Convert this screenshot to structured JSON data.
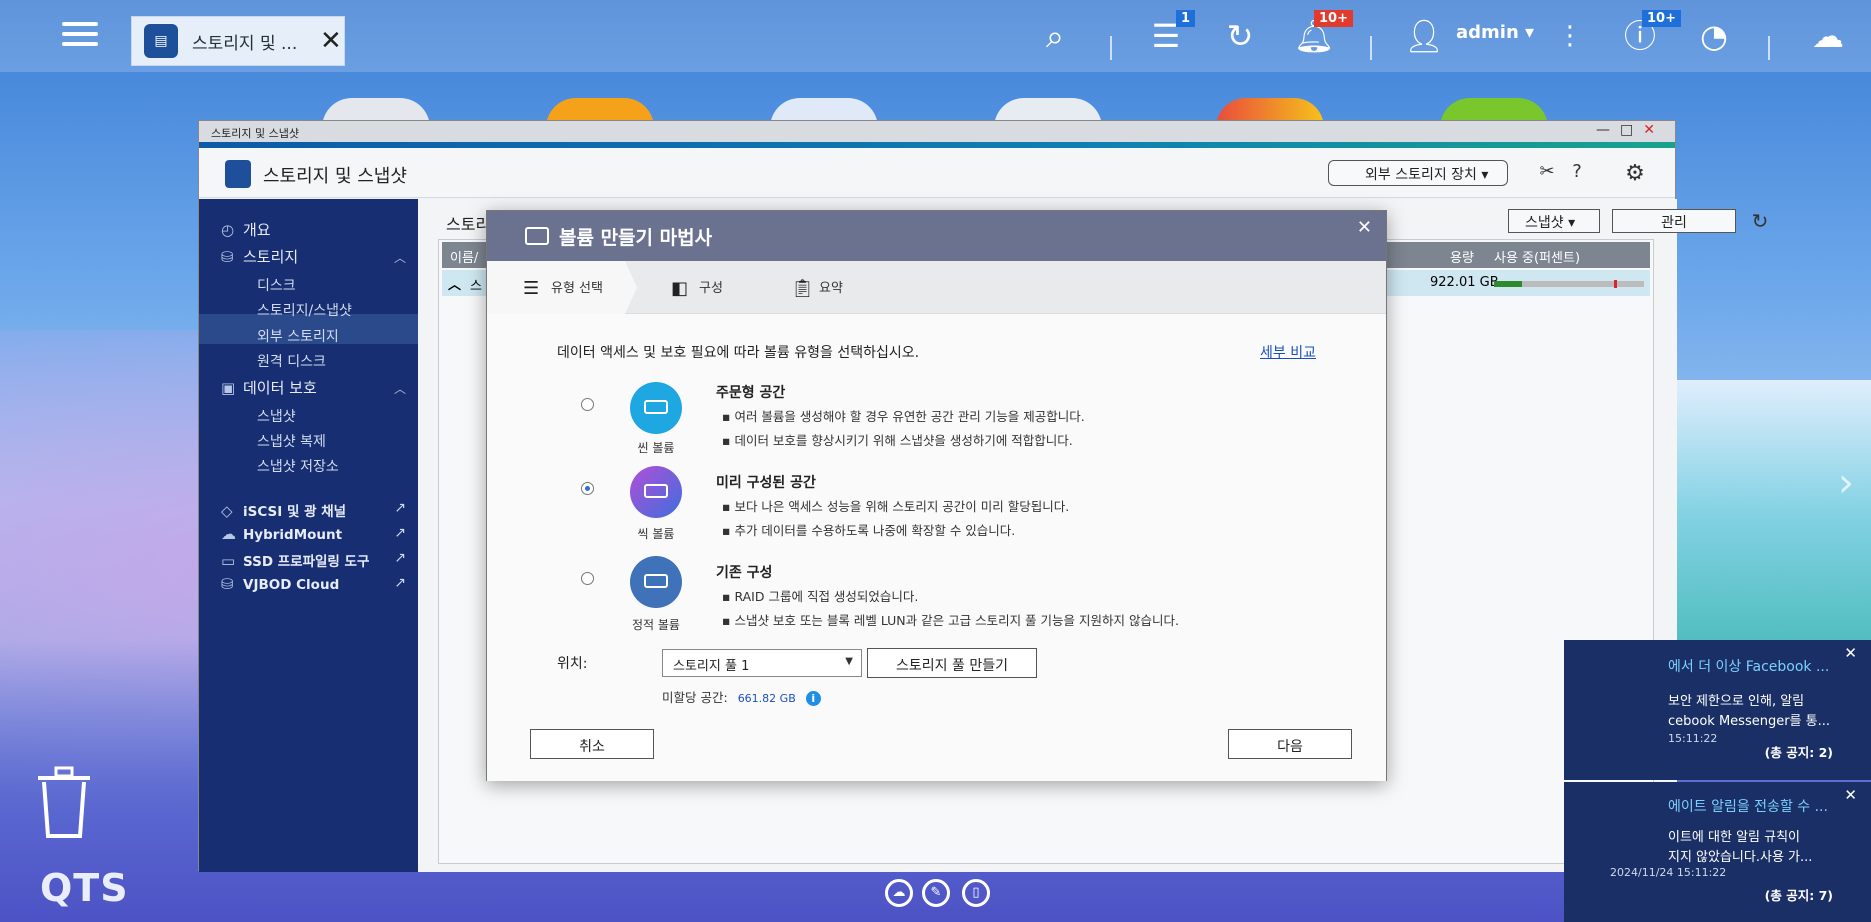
{
  "topbar": {
    "tab_label": "스토리지 및 ...",
    "tab_badge_tasks": "1",
    "tab_badge_notifications": "10+",
    "user": "admin",
    "tab_badge_info": "10+"
  },
  "window": {
    "titlebar": "스토리지 및 스냅샷",
    "app_title": "스토리지 및 스냅샷",
    "external_device_label": "외부 스토리지 장치"
  },
  "sidebar": {
    "overview": "개요",
    "storage": "스토리지",
    "disks": "디스크",
    "storage_snapshots": "스토리지/스냅샷",
    "external_storage": "외부 스토리지",
    "remote_disk": "원격 디스크",
    "data_protection": "데이터 보호",
    "snapshot": "스냅샷",
    "snapshot_replica": "스냅샷 복제",
    "snapshot_vault": "스냅샷 저장소",
    "iscsi": "iSCSI 및 광 채널",
    "hybridmount": "HybridMount",
    "ssd_profiling": "SSD 프로파일링 도구",
    "vjbod": "VJBOD Cloud"
  },
  "content": {
    "heading": "스토리",
    "snapshot_btn": "스냅샷",
    "manage_btn": "관리",
    "col_name": "이름/",
    "col_capacity": "용량",
    "col_usage": "사용 중(퍼센트)",
    "row_prefix": "스",
    "row_capacity": "922.01 GB"
  },
  "dialog": {
    "title": "볼륨 만들기 마법사",
    "steps": [
      "유형 선택",
      "구성",
      "요약"
    ],
    "intro": "데이터 액세스 및 보호 필요에 따라 볼륨 유형을 선택하십시오.",
    "compare_link": "세부 비교",
    "options": [
      {
        "label": "씬 볼륨",
        "title": "주문형 공간",
        "bullets": [
          "여러 볼륨을 생성해야 할 경우 유연한 공간 관리 기능을 제공합니다.",
          "데이터 보호를 향상시키기 위해 스냅샷을 생성하기에 적합합니다."
        ],
        "color": "#1ea7e0"
      },
      {
        "label": "씩 볼륨",
        "title": "미리 구성된 공간",
        "bullets": [
          "보다 나은 액세스 성능을 위해 스토리지 공간이 미리 할당됩니다.",
          "추가 데이터를 수용하도록 나중에 확장할 수 있습니다."
        ],
        "color": "#7a4fd8"
      },
      {
        "label": "정적 볼륨",
        "title": "기존 구성",
        "bullets": [
          "RAID 그룹에 직접 생성되었습니다.",
          "스냅샷 보호 또는 블록 레벨 LUN과 같은 고급 스토리지 풀 기능을 지원하지 않습니다."
        ],
        "color": "#3f72b8"
      }
    ],
    "location_label": "위치:",
    "location_value": "스토리지 풀 1",
    "create_pool_btn": "스토리지 풀 만들기",
    "free_space_label": "미할당 공간:",
    "free_space_value": "661.82 GB",
    "cancel": "취소",
    "next": "다음"
  },
  "notifications": [
    {
      "title": "에서 더 이상 Facebook ...",
      "line1": "보안 제한으로 인해, 알림",
      "line2": "cebook Messenger를 통...",
      "time": "15:11:22",
      "count": "(총 공지: 2)"
    },
    {
      "title": "에이트 알림을 전송할 수 ...",
      "line1": "이트에 대한 알림 규칙이",
      "line2": "지지 않았습니다.사용 가...",
      "time": "2024/11/24 15:11:22",
      "count": "(총 공지: 7)"
    }
  ],
  "desktop": {
    "brand": "QTS"
  }
}
